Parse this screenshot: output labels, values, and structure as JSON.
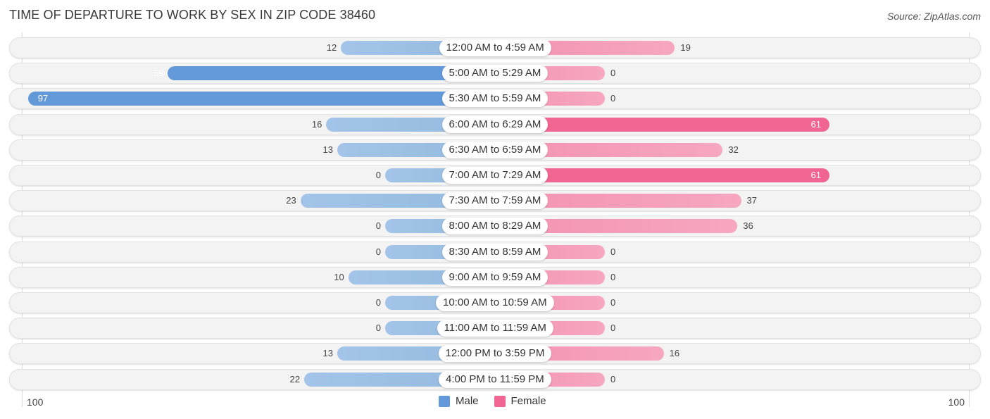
{
  "header": {
    "title": "TIME OF DEPARTURE TO WORK BY SEX IN ZIP CODE 38460",
    "source": "Source: ZipAtlas.com"
  },
  "colors": {
    "male": "#6399d9",
    "female": "#f06591"
  },
  "chart_data": {
    "type": "bar",
    "orientation": "horizontal-diverging",
    "title": "TIME OF DEPARTURE TO WORK BY SEX IN ZIP CODE 38460",
    "categories": [
      "12:00 AM to 4:59 AM",
      "5:00 AM to 5:29 AM",
      "5:30 AM to 5:59 AM",
      "6:00 AM to 6:29 AM",
      "6:30 AM to 6:59 AM",
      "7:00 AM to 7:29 AM",
      "7:30 AM to 7:59 AM",
      "8:00 AM to 8:29 AM",
      "8:30 AM to 8:59 AM",
      "9:00 AM to 9:59 AM",
      "10:00 AM to 10:59 AM",
      "11:00 AM to 11:59 AM",
      "12:00 PM to 3:59 PM",
      "4:00 PM to 11:59 PM"
    ],
    "series": [
      {
        "name": "Male",
        "values": [
          12,
          59,
          97,
          16,
          13,
          0,
          23,
          0,
          0,
          10,
          0,
          0,
          13,
          22
        ]
      },
      {
        "name": "Female",
        "values": [
          19,
          0,
          0,
          61,
          32,
          61,
          37,
          36,
          0,
          0,
          0,
          0,
          16,
          0
        ]
      }
    ],
    "axis": {
      "left_label": "100",
      "right_label": "100",
      "range": [
        0,
        100
      ]
    },
    "legend": {
      "position": "bottom-center",
      "entries": [
        "Male",
        "Female"
      ]
    }
  }
}
